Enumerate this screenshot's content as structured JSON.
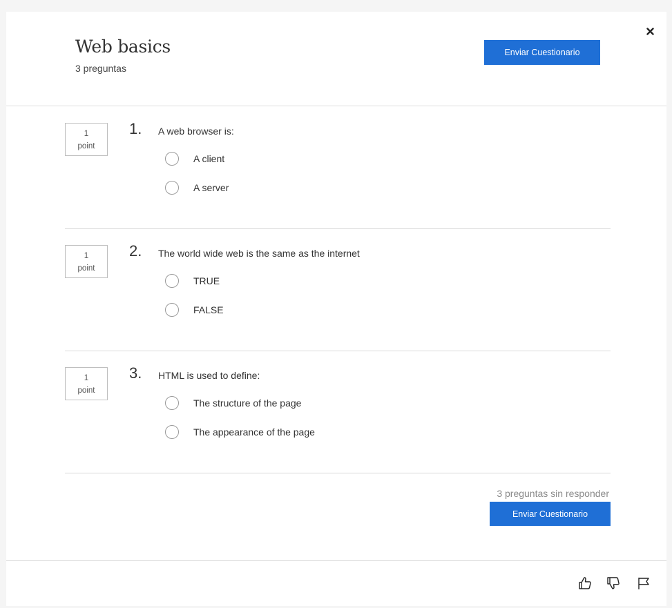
{
  "quiz": {
    "title": "Web basics",
    "subtitle": "3 preguntas",
    "submit_label": "Enviar Cuestionario",
    "unanswered_text": "3 preguntas sin responder"
  },
  "icons": {
    "close": "close-icon",
    "like": "thumbs-up-icon",
    "dislike": "thumbs-down-icon",
    "flag": "flag-icon"
  },
  "colors": {
    "accent": "#1f6fd6",
    "background": "#f5f5f5",
    "panel": "#ffffff"
  },
  "questions": [
    {
      "points_value": "1",
      "points_unit": "point",
      "number": "1.",
      "text": "A web browser is:",
      "options": [
        "A client",
        "A server"
      ]
    },
    {
      "points_value": "1",
      "points_unit": "point",
      "number": "2.",
      "text": "The world wide web is the same as the internet",
      "options": [
        "TRUE",
        "FALSE"
      ]
    },
    {
      "points_value": "1",
      "points_unit": "point",
      "number": "3.",
      "text": "HTML is used to define:",
      "options": [
        "The structure of the page",
        "The appearance of the page"
      ]
    }
  ]
}
